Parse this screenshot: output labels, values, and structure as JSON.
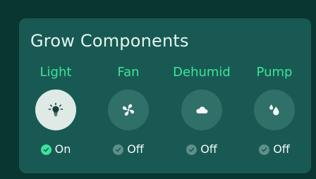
{
  "panel": {
    "title": "Grow Components"
  },
  "components": [
    {
      "label": "Light",
      "icon": "lightbulb-icon",
      "state": "On",
      "active": true
    },
    {
      "label": "Fan",
      "icon": "fan-icon",
      "state": "Off",
      "active": false
    },
    {
      "label": "Dehumid",
      "icon": "cloud-icon",
      "state": "Off",
      "active": false
    },
    {
      "label": "Pump",
      "icon": "water-drops-icon",
      "state": "Off",
      "active": false
    }
  ],
  "colors": {
    "background": "#093631",
    "card": "#185a53",
    "accent": "#3ee39a",
    "button_on": "#dfe9e6",
    "button_off": "#2f7068",
    "check_off": "#5e8f88"
  }
}
